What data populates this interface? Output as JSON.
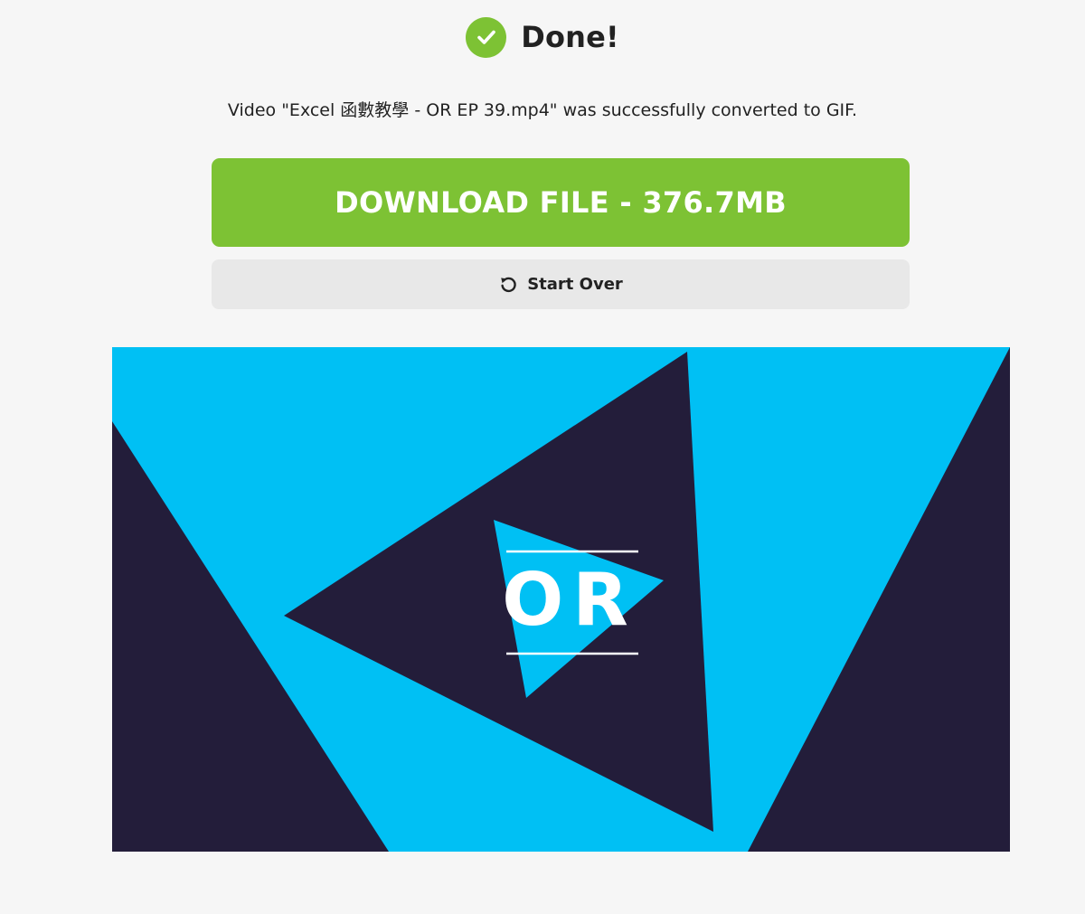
{
  "status": {
    "title": "Done!",
    "icon": "check-circle-icon",
    "message": "Video \"Excel 函數教學 - OR EP 39.mp4\" was successfully converted to GIF."
  },
  "actions": {
    "download_label": "DOWNLOAD FILE - 376.7MB",
    "start_over_label": "Start Over",
    "start_over_icon": "refresh-icon"
  },
  "preview": {
    "logo_text": "OR"
  },
  "colors": {
    "accent_green": "#7dc234",
    "secondary_button": "#e8e8e8",
    "preview_cyan": "#00c0f4",
    "preview_navy": "#231d3a",
    "background": "#f6f6f6"
  }
}
